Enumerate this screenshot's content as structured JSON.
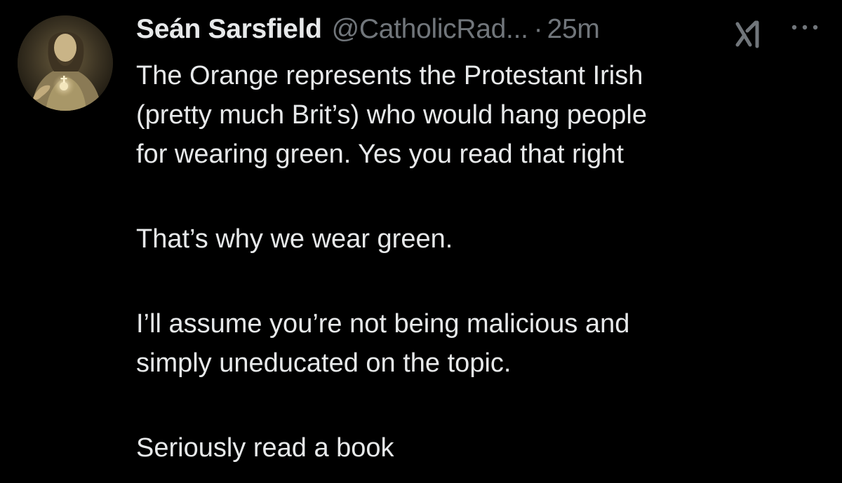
{
  "tweet": {
    "display_name": "Seán Sarsfield",
    "handle": "@CatholicRad...",
    "separator": "·",
    "timestamp": "25m",
    "avatar_icon": "sacred-heart-avatar",
    "grok_icon": "grok-icon",
    "more_icon": "more-horizontal-icon",
    "text_lines": [
      "The Orange represents the Protestant Irish",
      "(pretty much Brit’s) who would hang people",
      "for wearing green. Yes you read that right",
      "That’s why we wear green.",
      "I’ll assume you’re not being malicious and",
      "simply uneducated on the topic.",
      "Seriously read a book"
    ]
  },
  "colors": {
    "background": "#000000",
    "primary_text": "#e7e9ea",
    "secondary_text": "#71767b"
  }
}
